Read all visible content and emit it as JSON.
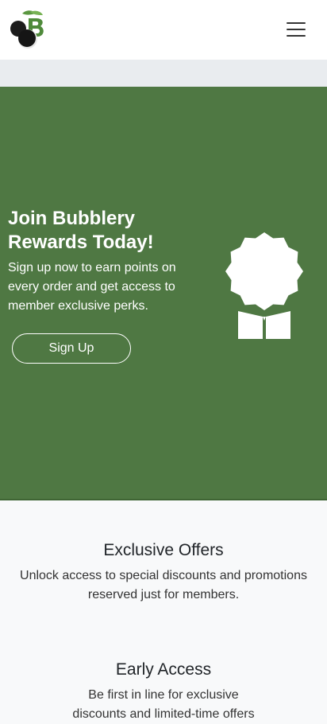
{
  "header": {
    "logo_icon": "bubblery-logo-icon",
    "menu_icon": "hamburger-menu-icon"
  },
  "colors": {
    "hero_bg": "#4f7843",
    "logo_green": "#4f8a3b",
    "gray_strip": "#e9ecef"
  },
  "hero": {
    "title": "Join Bubblery Rewards Today!",
    "text": "Sign up now to earn points on every order and get access to member exclusive perks.",
    "button_label": "Sign Up",
    "badge_icon": "award-ribbon-icon"
  },
  "benefits": [
    {
      "title": "Exclusive Offers",
      "text": "Unlock access to special discounts and promotions reserved just for members."
    },
    {
      "title": "Early Access",
      "text": "Be first in line for exclusive discounts and limited-time offers"
    }
  ]
}
